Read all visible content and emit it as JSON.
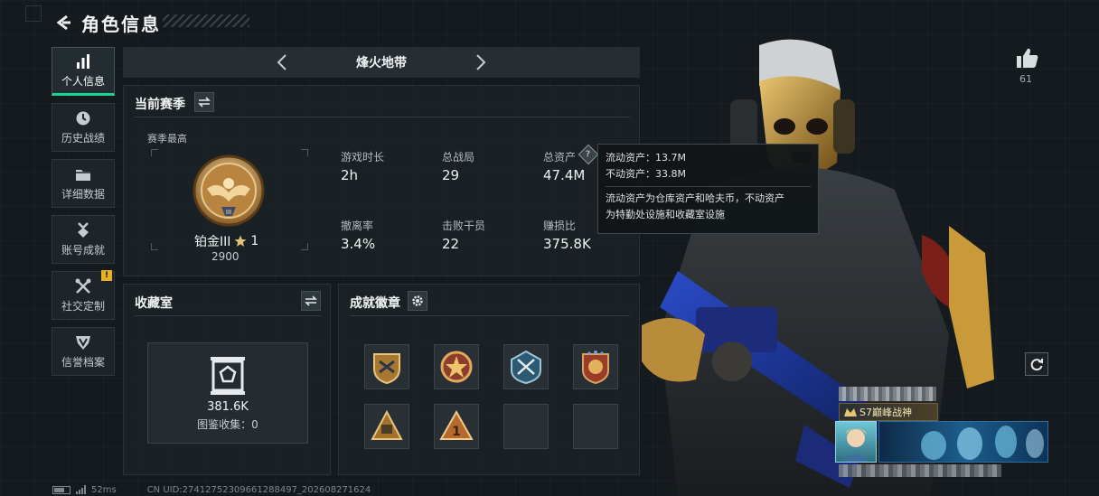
{
  "header": {
    "title": "角色信息"
  },
  "sidenav": {
    "items": [
      {
        "label": "个人信息",
        "active": true,
        "icon": "bar-chart-icon"
      },
      {
        "label": "历史战绩",
        "active": false,
        "icon": "clock-icon"
      },
      {
        "label": "详细数据",
        "active": false,
        "icon": "folder-icon"
      },
      {
        "label": "账号成就",
        "active": false,
        "icon": "medal-icon"
      },
      {
        "label": "社交定制",
        "active": false,
        "icon": "tools-icon",
        "badge": "!"
      },
      {
        "label": "信誉档案",
        "active": false,
        "icon": "shield-icon"
      }
    ]
  },
  "season_selector": {
    "name": "烽火地带"
  },
  "season_panel": {
    "title": "当前赛季",
    "season_best_label": "赛季最高",
    "rank_name": "铂金III",
    "rank_stars": "1",
    "rank_score": "2900",
    "stats": [
      {
        "label": "游戏时长",
        "value": "2h"
      },
      {
        "label": "总战局",
        "value": "29"
      },
      {
        "label": "总资产",
        "value": "47.4M"
      },
      {
        "label": "撤离率",
        "value": "3.4%"
      },
      {
        "label": "击败干员",
        "value": "22"
      },
      {
        "label": "赚损比",
        "value": "375.8K"
      }
    ],
    "help_glyph": "?"
  },
  "tooltip": {
    "liquid": "流动资产：13.7M",
    "fixed": "不动资产：33.8M",
    "note_line1": "流动资产为仓库资产和哈夫币，不动资产",
    "note_line2": "为特勤处设施和收藏室设施"
  },
  "collection_panel": {
    "title": "收藏室",
    "value": "381.6K",
    "count_text": "图鉴收集：0"
  },
  "achievement_panel": {
    "title": "成就徽章",
    "badge_count": 6,
    "empty_slots": 2
  },
  "profile": {
    "likes": "61",
    "title_tag": "S7巅峰战神"
  },
  "statusbar": {
    "ping": "52ms",
    "uid": "CN UID:27412752309661288497_202608271624"
  },
  "colors": {
    "accent": "#1bd692",
    "badge": "#e8b322",
    "gold": "#c9953c"
  }
}
